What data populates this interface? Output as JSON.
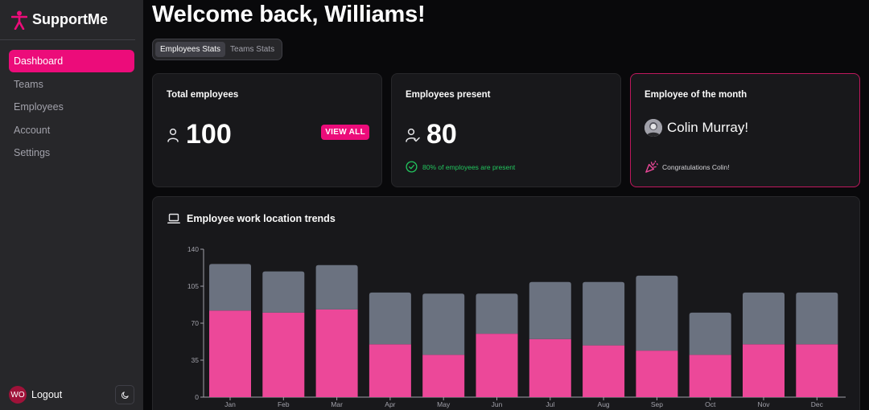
{
  "brand": {
    "name": "SupportMe"
  },
  "sidebar": {
    "items": [
      {
        "label": "Dashboard",
        "active": true
      },
      {
        "label": "Teams",
        "active": false
      },
      {
        "label": "Employees",
        "active": false
      },
      {
        "label": "Account",
        "active": false
      },
      {
        "label": "Settings",
        "active": false
      }
    ],
    "footer": {
      "avatar_initials": "WO",
      "logout_label": "Logout"
    }
  },
  "header": {
    "title": "Welcome back, Williams!"
  },
  "tabs": [
    {
      "label": "Employees Stats",
      "active": true
    },
    {
      "label": "Teams Stats",
      "active": false
    }
  ],
  "cards": {
    "total": {
      "title": "Total employees",
      "value": "100",
      "button": "VIEW ALL"
    },
    "present": {
      "title": "Employees present",
      "value": "80",
      "note": "80% of employees are present"
    },
    "eom": {
      "title": "Employee of the month",
      "name": "Colin Murray!",
      "note": "Congratulations Colin!"
    }
  },
  "colors": {
    "accent": "#ec0c7a",
    "bar_office": "#ec4899",
    "bar_remote": "#6b7280",
    "success": "#22c55e"
  },
  "chart_title": "Employee work location trends",
  "chart_data": {
    "type": "bar",
    "stacked": true,
    "title": "Employee work location trends",
    "categories": [
      "Jan",
      "Feb",
      "Mar",
      "Apr",
      "May",
      "Jun",
      "Jul",
      "Aug",
      "Sep",
      "Oct",
      "Nov",
      "Dec"
    ],
    "series": [
      {
        "values": [
          82,
          80,
          83,
          50,
          40,
          60,
          55,
          49,
          44,
          40,
          50,
          50
        ],
        "color": "#ec4899"
      },
      {
        "values": [
          44,
          39,
          42,
          49,
          58,
          38,
          54,
          60,
          71,
          40,
          49,
          49
        ],
        "color": "#6b7280"
      }
    ],
    "ylim": [
      0,
      140
    ],
    "yticks": [
      0,
      35,
      70,
      105,
      140
    ],
    "grid": false
  }
}
